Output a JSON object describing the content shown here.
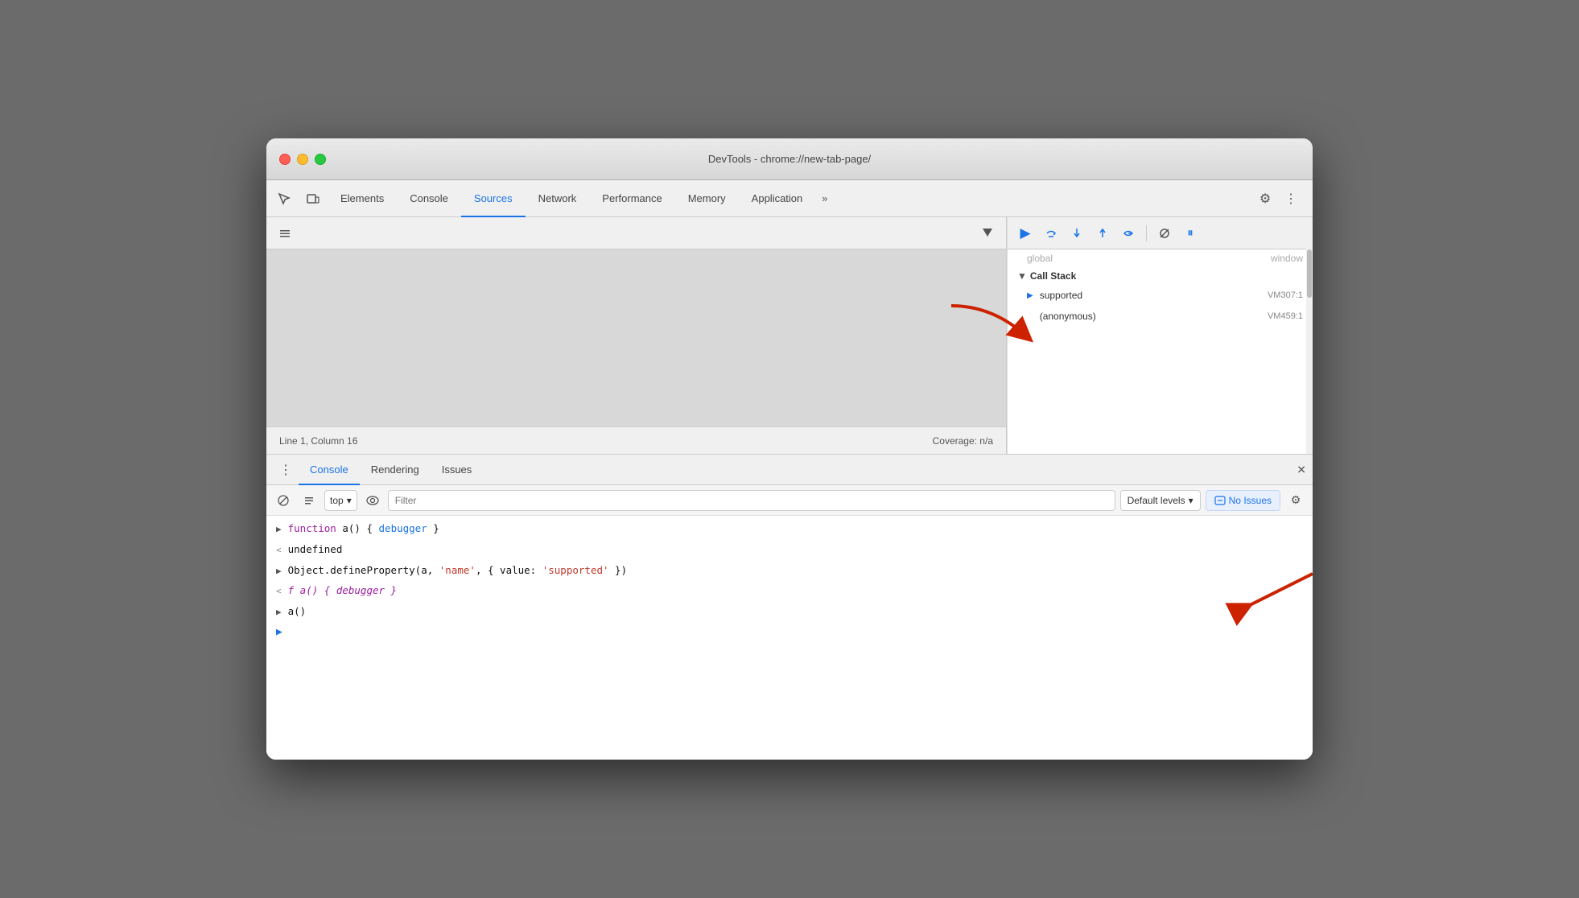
{
  "window": {
    "title": "DevTools - chrome://new-tab-page/"
  },
  "tabs": {
    "inspect_icon": "⬚",
    "device_icon": "▭",
    "elements": "Elements",
    "console": "Console",
    "sources": "Sources",
    "network": "Network",
    "performance": "Performance",
    "memory": "Memory",
    "application": "Application",
    "more": "»",
    "settings_icon": "⚙",
    "more_vert": "⋮"
  },
  "debugger_toolbar": {
    "resume": "▶",
    "step_over": "↷",
    "step_into": "↓",
    "step_out": "↑",
    "step": "→",
    "deactivate": "⊘",
    "pause": "⏸"
  },
  "call_stack": {
    "header": "Call Stack",
    "items": [
      {
        "name": "supported",
        "location": "VM307:1",
        "current": true
      },
      {
        "name": "(anonymous)",
        "location": "VM459:1",
        "current": false
      }
    ],
    "blurred_top": "global",
    "blurred_location": "window"
  },
  "status_bar": {
    "position": "Line 1, Column 16",
    "coverage": "Coverage: n/a"
  },
  "console_tabs": {
    "console": "Console",
    "rendering": "Rendering",
    "issues": "Issues"
  },
  "console_toolbar": {
    "clear": "🚫",
    "context": "top",
    "eye": "👁",
    "filter_placeholder": "Filter",
    "levels": "Default levels",
    "no_issues_icon": "🗩",
    "no_issues": "No Issues"
  },
  "console_lines": [
    {
      "type": "input",
      "arrow": ">",
      "parts": [
        {
          "text": "function",
          "class": "keyword"
        },
        {
          "text": " a() { ",
          "class": "text"
        },
        {
          "text": "debugger",
          "class": "fn-name"
        },
        {
          "text": " }",
          "class": "text"
        }
      ]
    },
    {
      "type": "result",
      "arrow": "<",
      "parts": [
        {
          "text": "undefined",
          "class": "text"
        }
      ]
    },
    {
      "type": "input",
      "arrow": ">",
      "parts": [
        {
          "text": "Object.defineProperty(a, ",
          "class": "text"
        },
        {
          "text": "'name'",
          "class": "string"
        },
        {
          "text": ", { value: ",
          "class": "text"
        },
        {
          "text": "'supported'",
          "class": "string"
        },
        {
          "text": " })",
          "class": "text"
        }
      ]
    },
    {
      "type": "result",
      "arrow": "<",
      "parts": [
        {
          "text": "f a() { debugger }",
          "class": "italic"
        }
      ]
    },
    {
      "type": "input",
      "arrow": ">",
      "parts": [
        {
          "text": "a()",
          "class": "text"
        }
      ]
    }
  ],
  "console_prompt": {
    "arrow": ">"
  },
  "colors": {
    "active_tab": "#1a73e8",
    "keyword_purple": "#9c1da0",
    "string_red": "#c0392b",
    "fn_blue": "#1a73e8"
  }
}
